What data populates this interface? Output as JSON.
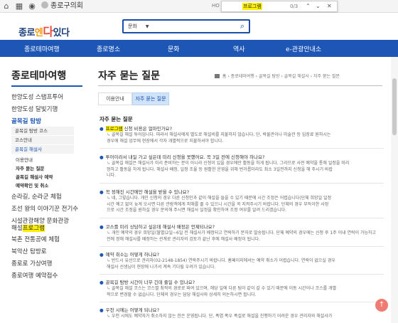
{
  "topbar": {
    "brand": "종로구의회",
    "header_tab_hint": "HO",
    "find": {
      "query": "프로그램",
      "count": "0/3",
      "up": "⌃",
      "down": "⌄",
      "close": "✕"
    }
  },
  "header": {
    "logo_pre": "종로",
    "logo_en": "엔",
    "logo_da": "다",
    "logo_post": "있다",
    "search_category": "문화"
  },
  "nav": [
    "종로테마여행",
    "종로명소",
    "문화",
    "역사",
    "e-관광안내소"
  ],
  "sidebar": {
    "title": "종로테마여행",
    "items": [
      "한양도성 스탬프투어",
      "한양도성 달빛기행",
      "골목길 탐방"
    ],
    "sub_items": [
      "골목길 탐방 코스",
      "코스안내",
      "골목길 해설사"
    ],
    "sub3": [
      "이용안내",
      "자주 묻는 질문",
      "골목길 해설사 예약",
      "예약확인 및 취소"
    ],
    "items2": [
      "순라길, 순라군 체험",
      "조선 왕의 이야기꾼 전기수",
      "시설관광해양 문화관광",
      "해설",
      "북촌 전통공예 체험",
      "북악산 탐방로",
      "종로로 가상여행",
      "종로여행 예약접수"
    ],
    "highlight": "프로그램"
  },
  "main": {
    "title": "자주 묻는 질문",
    "breadcrumb": [
      "홈",
      "종로테마여행",
      "골목길 탐방",
      "골목길 해설사",
      "자주 묻는 질문"
    ],
    "tabs": [
      "이용안내",
      "자주 묻는 질문"
    ],
    "section_title": "자주 묻는 질문",
    "faqs": [
      {
        "q_hl": "프로그램",
        "q": " 신청 비용은 얼마인가요?",
        "a": [
          "골목길 해설 투어입니다. 따라서 해설사에게 별도로 해설비를 지불하지 않습니다. 단, 박물관이나 미술관 등 입장료 원하시는",
          "경우에 해설 업무에 현장에서 각자 개별적으로 지불하셔야 합니다."
        ]
      },
      {
        "q_hl": "",
        "q": "투어이라서 내일 가고 싶은데 미리 신청을 못했어요. 꼭 3일 전에 신청해야 하나요?",
        "a": [
          "골목길 해설은 해설사가 미리 준비하는 분이 아니라 신청이 있을 경우에만 활동을 하게 됩니다. 그리므로 사전 예약을 통해 일정을 미리",
          "정하고 활동을 하게 됩니다. 해설사 배정, 일정 조율 등 원활한 운영을 위해 번거롭더라도 최소 3일전까지 신청을 해 주시기 바랍",
          "니다."
        ]
      },
      {
        "q_hl": "",
        "q": "꼭 정해진 시간에만 해설을 받을 수 있나요?",
        "a": [
          "네, 그렇습니다. 개인 신청의 경우 다른 신청인과 같이 해설을 들을 수 있기 때문에 시간 조정은 어렵습니다(단체 희망일 일정",
          "시간 예고 없이 늦게 오시면 다른 관람객에게 피해를 줄 수 있으니 시간을 꼭 지켜주시기 바랍니다. 단체의 경우 부득이한 사정",
          "으로 시간 조정을 원하실 경우 문의해 주시면 해설사 일정을 확인하여 조정 여부를 알려 드리겠습니다."
        ]
      },
      {
        "q_hl": "",
        "q": "코스를 미리 상담하고 싶은데 해설사 배정은 언제되나요?",
        "a": [
          "개인 예약의 경우 희망일(월별)2일~6일 전 해설사가 배정되고 연락하기 문자로 발송됩니다. 단체 예약의 경우에는 신청 후 1주 이내 연락이 가능하고",
          "전에 정해 해설사를 배정하는 관계로 관리자의 검토가 끝난 후에 해설사 배정이 됩니다."
        ]
      },
      {
        "q_hl": "",
        "q": "예약 취소는 어떻게 하나요?",
        "a": [
          "반드시 유선으로 관리자(02-2148-1854) 연락주시기 바랍니다. 홈페이지에서는 예약 취소가 어렵습니다. 연락이 없으실 경우",
          "해설사 선생님이 현장에 나가서 계속 기다릴 우려가 있습니다."
        ]
      },
      {
        "q_hl": "",
        "q": "골목길 탐방 시간이 너무 긴데 줄일 수 있나요?",
        "a": [
          "골목길 해설 코스는 코스별 최적의 경로로 짜여 있으며, 해당 일에 다른 팀이 같이 갈 수 있기 때문에 이동 시간이나 코스를 개별",
          "적으로 변경할 수 없습니다. 단체의 경우는 담당 해설사와 상세히 의논하시면 됩니다."
        ]
      },
      {
        "q_hl": "",
        "q": "우천 시에는 어떻게 되나요?",
        "a": [
          "우천 시에도 예약자가 취소하지 않는 한은 운영됩니다. 단, 폭염 폭우 폭설로 해설을 진행하기 어려운 경우 관리자와 해설사가"
        ]
      }
    ]
  }
}
